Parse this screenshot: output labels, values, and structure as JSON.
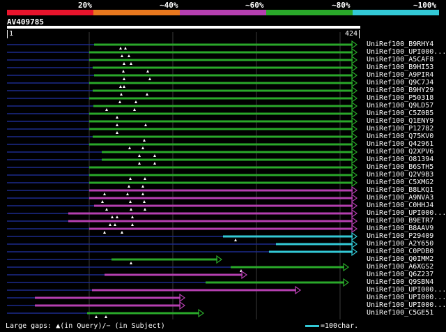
{
  "query": {
    "name": "AV409785",
    "start_label": "1",
    "end_label": "424"
  },
  "scale": {
    "colors": [
      "#e8142c",
      "#e8781e",
      "#b53fb0",
      "#2aa82a",
      "#33c9d6"
    ],
    "labels": [
      "20%",
      "~40%",
      "~60%",
      "~80%",
      "~100%"
    ]
  },
  "hits": [
    {
      "name": "UniRef100_B9RHY4",
      "color": "#2aa82a",
      "dash": [
        10,
        135
      ],
      "s": [
        135,
        512
      ],
      "tri": [
        173,
        180
      ]
    },
    {
      "name": "UniRef100_UPI000...",
      "color": "#2aa82a",
      "dash": [
        10,
        128
      ],
      "s": [
        128,
        512
      ],
      "tri": [
        175,
        185
      ]
    },
    {
      "name": "UniRef100_A5CAF8",
      "color": "#2aa82a",
      "dash": [
        10,
        128
      ],
      "s": [
        128,
        512
      ],
      "tri": [
        178,
        188
      ]
    },
    {
      "name": "UniRef100_B9HI53",
      "color": "#2aa82a",
      "dash": [
        10,
        133
      ],
      "s": [
        133,
        512
      ],
      "tri": [
        177,
        212
      ]
    },
    {
      "name": "UniRef100_A9PIR4",
      "color": "#2aa82a",
      "dash": [
        10,
        135
      ],
      "s": [
        135,
        512
      ],
      "tri": [
        178,
        215
      ]
    },
    {
      "name": "UniRef100_Q9C7J4",
      "color": "#2aa82a",
      "dash": [
        10,
        128
      ],
      "s": [
        128,
        512
      ],
      "tri": [
        173,
        178
      ]
    },
    {
      "name": "UniRef100_B9HY29",
      "color": "#2aa82a",
      "dash": [
        10,
        133
      ],
      "s": [
        133,
        512
      ],
      "tri": [
        174,
        211
      ]
    },
    {
      "name": "UniRef100_P50318",
      "color": "#2aa82a",
      "dash": [
        10,
        128
      ],
      "s": [
        128,
        512
      ],
      "tri": [
        172,
        195
      ]
    },
    {
      "name": "UniRef100_Q9LD57",
      "color": "#2aa82a",
      "dash": [
        10,
        134
      ],
      "s": [
        134,
        512
      ],
      "tri": [
        153,
        193
      ]
    },
    {
      "name": "UniRef100_C5Z0B5",
      "color": "#2aa82a",
      "dash": [
        10,
        128
      ],
      "s": [
        128,
        512
      ],
      "tri": [
        168
      ]
    },
    {
      "name": "UniRef100_Q1ENY9",
      "color": "#2aa82a",
      "dash": [
        10,
        128
      ],
      "s": [
        128,
        512
      ],
      "tri": [
        168,
        209
      ]
    },
    {
      "name": "UniRef100_P12782",
      "color": "#2aa82a",
      "dash": [
        10,
        128
      ],
      "s": [
        128,
        512
      ],
      "tri": [
        168
      ]
    },
    {
      "name": "UniRef100_Q75KV0",
      "color": "#2aa82a",
      "dash": [
        10,
        133
      ],
      "s": [
        133,
        512
      ],
      "tri": [
        207
      ]
    },
    {
      "name": "UniRef100_Q42961",
      "color": "#2aa82a",
      "dash": [
        10,
        128
      ],
      "s": [
        128,
        512
      ],
      "tri": [
        186,
        205
      ]
    },
    {
      "name": "UniRef100_Q2XPV6",
      "color": "#2aa82a",
      "dash": [
        10,
        146
      ],
      "s": [
        146,
        512
      ],
      "tri": [
        200,
        222
      ]
    },
    {
      "name": "UniRef100_O81394",
      "color": "#2aa82a",
      "dash": [
        10,
        146
      ],
      "s": [
        146,
        512
      ],
      "tri": [
        200,
        222
      ]
    },
    {
      "name": "UniRef100_B6STH5",
      "color": "#2aa82a",
      "dash": [
        10,
        128
      ],
      "s": [
        128,
        512
      ],
      "tri": []
    },
    {
      "name": "UniRef100_Q2V9B3",
      "color": "#2aa82a",
      "dash": [
        10,
        128
      ],
      "s": [
        128,
        512
      ],
      "tri": [
        187,
        208
      ]
    },
    {
      "name": "UniRef100_C5XMG2",
      "color": "#2aa82a",
      "dash": [
        10,
        128
      ],
      "s": [
        128,
        512
      ],
      "tri": [
        185,
        205
      ]
    },
    {
      "name": "UniRef100_B8LKQ1",
      "color": "#b53fb0",
      "dash": [
        10,
        128
      ],
      "s": [
        128,
        512
      ],
      "tri": [
        150,
        183,
        205
      ]
    },
    {
      "name": "UniRef100_A9NVA3",
      "color": "#b53fb0",
      "dash": [
        10,
        128
      ],
      "s": [
        128,
        512
      ],
      "tri": [
        147,
        187,
        207
      ]
    },
    {
      "name": "UniRef100_C0HHJ4",
      "color": "#b53fb0",
      "dash": [
        10,
        135
      ],
      "s": [
        135,
        512
      ],
      "tri": [
        153,
        188,
        208
      ]
    },
    {
      "name": "UniRef100_UPI000...",
      "color": "#b53fb0",
      "dash": [
        10,
        98
      ],
      "s": [
        98,
        512
      ],
      "tri": [
        161,
        168,
        190
      ]
    },
    {
      "name": "UniRef100_B9ETR7",
      "color": "#b53fb0",
      "dash": [
        10,
        98
      ],
      "s": [
        98,
        512
      ],
      "tri": [
        158,
        165,
        190
      ]
    },
    {
      "name": "UniRef100_B8AAV9",
      "color": "#b53fb0",
      "dash": [
        10,
        128
      ],
      "s": [
        128,
        512
      ],
      "tri": [
        150,
        175
      ]
    },
    {
      "name": "UniRef100_P29409",
      "color": "#33c9d6",
      "dash": [
        10,
        320
      ],
      "s": [
        320,
        512
      ],
      "tri": [
        338
      ]
    },
    {
      "name": "UniRef100_A2Y650",
      "color": "#33c9d6",
      "dash": [
        10,
        396
      ],
      "s": [
        396,
        512
      ],
      "tri": []
    },
    {
      "name": "UniRef100_C0PDB0",
      "color": "#33c9d6",
      "dash": [
        10,
        386
      ],
      "s": [
        386,
        512
      ],
      "tri": []
    },
    {
      "name": "UniRef100_Q0IMM2",
      "color": "#2aa82a",
      "dash": [
        10,
        160
      ],
      "s": [
        160,
        318
      ],
      "tri": [
        188
      ]
    },
    {
      "name": "UniRef100_A6XGS2",
      "color": "#2aa82a",
      "dash": [
        10,
        331
      ],
      "s": [
        331,
        500
      ],
      "tri": [
        346
      ]
    },
    {
      "name": "UniRef100_Q6Z237",
      "color": "#b53fb0",
      "dash": [
        10,
        150
      ],
      "s": [
        150,
        354
      ],
      "tri": []
    },
    {
      "name": "UniRef100_Q9SBN4",
      "color": "#2aa82a",
      "dash": [
        10,
        295
      ],
      "s": [
        295,
        500
      ],
      "tri": []
    },
    {
      "name": "UniRef100_UPI000...",
      "color": "#b53fb0",
      "dash": [
        10,
        132
      ],
      "s": [
        132,
        431
      ],
      "tri": []
    },
    {
      "name": "UniRef100_UPI000...",
      "color": "#b53fb0",
      "dash": [
        10,
        50
      ],
      "s": [
        50,
        265
      ],
      "tri": []
    },
    {
      "name": "UniRef100_UPI000...",
      "color": "#b53fb0",
      "dash": [
        10,
        50
      ],
      "s": [
        50,
        265
      ],
      "tri": []
    },
    {
      "name": "UniRef100_C5GE51",
      "color": "#2aa82a",
      "dash": [
        10,
        125
      ],
      "s": [
        125,
        292
      ],
      "tri": [
        138,
        152
      ]
    }
  ],
  "legend": {
    "gaps_text": "Large gaps: ▲(in Query)/− (in Subject)",
    "scale_text": "=100char."
  }
}
